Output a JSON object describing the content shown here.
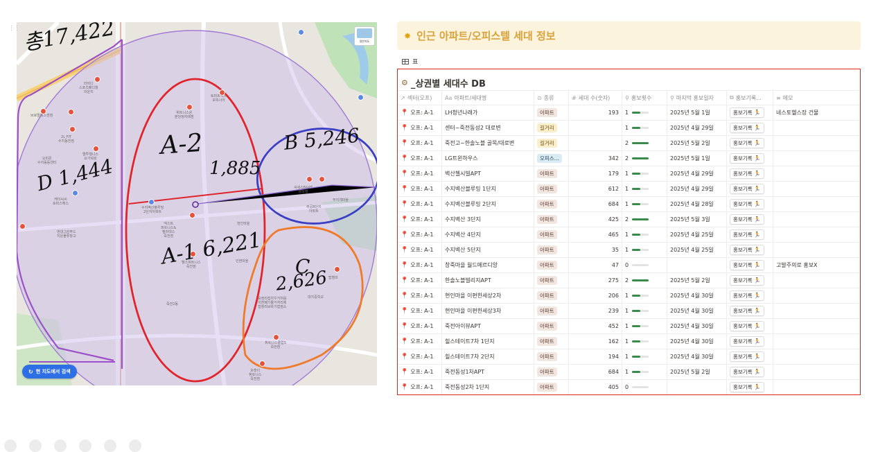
{
  "map": {
    "search_here_label": "현 지도에서 검색",
    "map_type_label": "일반지도",
    "handwriting": {
      "total": "총17,422",
      "a2_name": "A-2",
      "a2_count": "1,885",
      "b_label": "B 5,246",
      "d_label": "D 1,444",
      "a1_label": "A-1 6,221",
      "c_name": "C",
      "c_count": "2,626"
    },
    "labels": [
      "라비디\n스포츠페디월\n라운지",
      "브로멀헤스센점",
      "2L FIT\n수지동천점",
      "엘투웰니스\n요가워킹",
      "오피온\n수지동동센터",
      "케이씨씨\n포피스헤스",
      "현대그린푸드\n지문물류창고",
      "휘트니스온\n분당정자매점",
      "토피트엑스\n모피시어",
      "넥스트\n피트니스&\n필라테스\n죽전점",
      "수지벽산블루밍\n2단지아파트",
      "헬스휘트니스\n죽전점",
      "현인마을",
      "죽전2동",
      "인현마을",
      "셔세스B&PT\n분당점",
      "무지개마을",
      "주공8단지\n아파트",
      "용정리접치우거처를\n이면폐기물거처리제\n법정리브바기접점소",
      "휘트니스클럽S\n죽전점",
      "보쟁이\n휘트니스\n죽전점",
      "탑캠프",
      "대지중학교"
    ]
  },
  "callout": {
    "icon": "lightbulb-icon",
    "title": "인근 아파트/오피스텔 세대 정보"
  },
  "view": {
    "tab_label": "표"
  },
  "db": {
    "title": "_상권별 세대수 DB",
    "columns": [
      {
        "icon": "↗",
        "label": "섹터(오프)"
      },
      {
        "icon": "Aa",
        "label": "아파트/세대명"
      },
      {
        "icon": "⊙",
        "label": "종류"
      },
      {
        "icon": "#",
        "label": "세대 수(숫자)"
      },
      {
        "icon": "⚲",
        "label": "홍보횟수"
      },
      {
        "icon": "⚲",
        "label": "마지막 홍보일자"
      },
      {
        "icon": "⧉",
        "label": "홍보기록..."
      },
      {
        "icon": "≡",
        "label": "메모"
      }
    ],
    "promo_label": "홍보기록",
    "rows": [
      {
        "sector": "오프: A-1",
        "name": "LH청년나래가",
        "type": "아파트",
        "type_style": "apt",
        "households": "193",
        "promo_count": 1,
        "last_date": "2025년 5월 1일",
        "memo": "네스토헬스장 건물"
      },
      {
        "sector": "오프: A-1",
        "name": "센터~죽전동성2 대로변",
        "type": "길거리",
        "type_style": "street",
        "households": "",
        "promo_count": 1,
        "last_date": "2025년 4월 29일",
        "memo": ""
      },
      {
        "sector": "오프: A-1",
        "name": "죽전고~한솔노블 골목/대로변",
        "type": "길거리",
        "type_style": "street",
        "households": "",
        "promo_count": 2,
        "last_date": "2025년 5월 2일",
        "memo": ""
      },
      {
        "sector": "오프: A-1",
        "name": "LG트윈하우스",
        "type": "오피스...",
        "type_style": "office",
        "households": "342",
        "promo_count": 2,
        "last_date": "2025년 5월 1일",
        "memo": ""
      },
      {
        "sector": "오프: A-1",
        "name": "벽산첼시빌APT",
        "type": "아파트",
        "type_style": "apt",
        "households": "179",
        "promo_count": 1,
        "last_date": "2025년 4월 29일",
        "memo": ""
      },
      {
        "sector": "오프: A-1",
        "name": "수지벽산블루밍 1단지",
        "type": "아파트",
        "type_style": "apt",
        "households": "612",
        "promo_count": 1,
        "last_date": "2025년 4월 29일",
        "memo": ""
      },
      {
        "sector": "오프: A-1",
        "name": "수지벽산블루밍 2단지",
        "type": "아파트",
        "type_style": "apt",
        "households": "684",
        "promo_count": 1,
        "last_date": "2025년 4월 28일",
        "memo": ""
      },
      {
        "sector": "오프: A-1",
        "name": "수지벽산 3단지",
        "type": "아파트",
        "type_style": "apt",
        "households": "425",
        "promo_count": 2,
        "last_date": "2025년 5월 3일",
        "memo": ""
      },
      {
        "sector": "오프: A-1",
        "name": "수지벽산 4단지",
        "type": "아파트",
        "type_style": "apt",
        "households": "465",
        "promo_count": 1,
        "last_date": "2025년 4월 25일",
        "memo": ""
      },
      {
        "sector": "오프: A-1",
        "name": "수지벽산 5단지",
        "type": "아파트",
        "type_style": "apt",
        "households": "35",
        "promo_count": 1,
        "last_date": "2025년 4월 25일",
        "memo": ""
      },
      {
        "sector": "오프: A-1",
        "name": "창죽마을 월드메르디앙",
        "type": "아파트",
        "type_style": "apt",
        "households": "47",
        "promo_count": 0,
        "last_date": "",
        "memo": "고발주의로 홍보X"
      },
      {
        "sector": "오프: A-1",
        "name": "한솔노블빌리지APT",
        "type": "아파트",
        "type_style": "apt",
        "households": "275",
        "promo_count": 2,
        "last_date": "2025년 5월 2일",
        "memo": ""
      },
      {
        "sector": "오프: A-1",
        "name": "현인마을 이편한세상2차",
        "type": "아파트",
        "type_style": "apt",
        "households": "206",
        "promo_count": 1,
        "last_date": "2025년 4월 30일",
        "memo": ""
      },
      {
        "sector": "오프: A-1",
        "name": "현인마을 이편한세상3차",
        "type": "아파트",
        "type_style": "apt",
        "households": "239",
        "promo_count": 1,
        "last_date": "2025년 4월 30일",
        "memo": ""
      },
      {
        "sector": "오프: A-1",
        "name": "죽전아이뷰APT",
        "type": "아파트",
        "type_style": "apt",
        "households": "452",
        "promo_count": 1,
        "last_date": "2025년 4월 30일",
        "memo": ""
      },
      {
        "sector": "오프: A-1",
        "name": "힐스테이트7차 1단지",
        "type": "아파트",
        "type_style": "apt",
        "households": "162",
        "promo_count": 1,
        "last_date": "2025년 4월 30일",
        "memo": ""
      },
      {
        "sector": "오프: A-1",
        "name": "힐스테이트7차 2단지",
        "type": "아파트",
        "type_style": "apt",
        "households": "194",
        "promo_count": 1,
        "last_date": "2025년 4월 30일",
        "memo": ""
      },
      {
        "sector": "오프: A-1",
        "name": "죽전동성1차APT",
        "type": "아파트",
        "type_style": "apt",
        "households": "684",
        "promo_count": 1,
        "last_date": "2025년 5월 2일",
        "memo": ""
      },
      {
        "sector": "오프: A-1",
        "name": "죽전동성2차 1단지",
        "type": "아파트",
        "type_style": "apt",
        "households": "405",
        "promo_count": 0,
        "last_date": "",
        "memo": ""
      }
    ]
  },
  "colors": {
    "zone_a2": "#e0242b",
    "zone_a1": "#e0242b",
    "zone_b": "#3a3fc4",
    "zone_c": "#ef7a2a",
    "zone_d": "#9b4fc9",
    "outer_circle": "#a07ad6",
    "callout_text": "#d9a23a",
    "frame": "#e0241a",
    "promo_bar": "#3a8a4c"
  }
}
